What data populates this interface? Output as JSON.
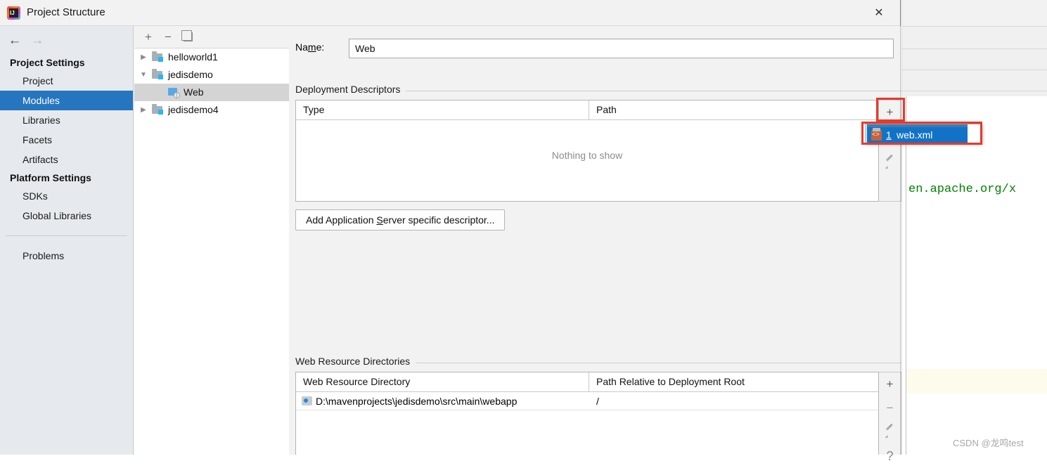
{
  "dialog": {
    "title": "Project Structure",
    "icon": "intellij-idea-icon",
    "close_label": "✕"
  },
  "background_ide": {
    "minimize_label": "—",
    "restore_label": "❐",
    "code_fragment": "en.apache.org/x",
    "watermark": "CSDN @龙鸣test"
  },
  "nav": {
    "back_label": "←",
    "forward_label": "→"
  },
  "sidebar": {
    "groups": [
      {
        "header": "Project Settings",
        "items": [
          {
            "label": "Project",
            "selected": false
          },
          {
            "label": "Modules",
            "selected": true
          },
          {
            "label": "Libraries",
            "selected": false
          },
          {
            "label": "Facets",
            "selected": false
          },
          {
            "label": "Artifacts",
            "selected": false
          }
        ]
      },
      {
        "header": "Platform Settings",
        "items": [
          {
            "label": "SDKs",
            "selected": false
          },
          {
            "label": "Global Libraries",
            "selected": false
          }
        ]
      }
    ],
    "problems_label": "Problems",
    "selected_color": "#2675bf"
  },
  "tree_toolbar": {
    "add_label": "+",
    "remove_label": "−",
    "copy_label": "copy-icon"
  },
  "tree": {
    "nodes": [
      {
        "label": "helloworld1",
        "indent": 0,
        "twisty": "collapsed",
        "icon": "module-folder-icon",
        "selected": false
      },
      {
        "label": "jedisdemo",
        "indent": 0,
        "twisty": "expanded",
        "icon": "module-folder-icon",
        "selected": false
      },
      {
        "label": "Web",
        "indent": 1,
        "twisty": "none",
        "icon": "web-facet-icon",
        "selected": true
      },
      {
        "label": "jedisdemo4",
        "indent": 0,
        "twisty": "collapsed",
        "icon": "module-folder-icon",
        "selected": false
      }
    ]
  },
  "content": {
    "name_label_pre": "Na",
    "name_label_mnemonic": "m",
    "name_label_post": "e:",
    "name_value": "Web",
    "name_placeholder": "",
    "deployment_descriptors": {
      "section_title": "Deployment Descriptors",
      "columns": [
        "Type",
        "Path"
      ],
      "rows": [],
      "empty_text": "Nothing to show",
      "buttons": [
        {
          "name": "add",
          "label": "+"
        },
        {
          "name": "edit",
          "label": "pencil-icon"
        }
      ]
    },
    "add_descriptor_button": {
      "pre": "Add Application ",
      "mnemonic": "S",
      "post": "erver specific descriptor..."
    },
    "web_resource_directories": {
      "section_title": "Web Resource Directories",
      "columns": [
        "Web Resource Directory",
        "Path Relative to Deployment Root"
      ],
      "rows": [
        {
          "directory": "D:\\mavenprojects\\jedisdemo\\src\\main\\webapp",
          "relative_path": "/"
        }
      ],
      "buttons": [
        {
          "name": "add",
          "label": "+"
        },
        {
          "name": "remove",
          "label": "−"
        },
        {
          "name": "edit",
          "label": "pencil-icon"
        },
        {
          "name": "help",
          "label": "?"
        }
      ]
    }
  },
  "popup_menu": {
    "items": [
      {
        "number": "1",
        "label": "web.xml",
        "icon": "xml-file-icon",
        "selected": true
      }
    ]
  },
  "annotations": {
    "color": "#e8392c",
    "boxes": [
      "add-descriptor-button-highlight",
      "web-xml-menu-item-highlight"
    ]
  }
}
